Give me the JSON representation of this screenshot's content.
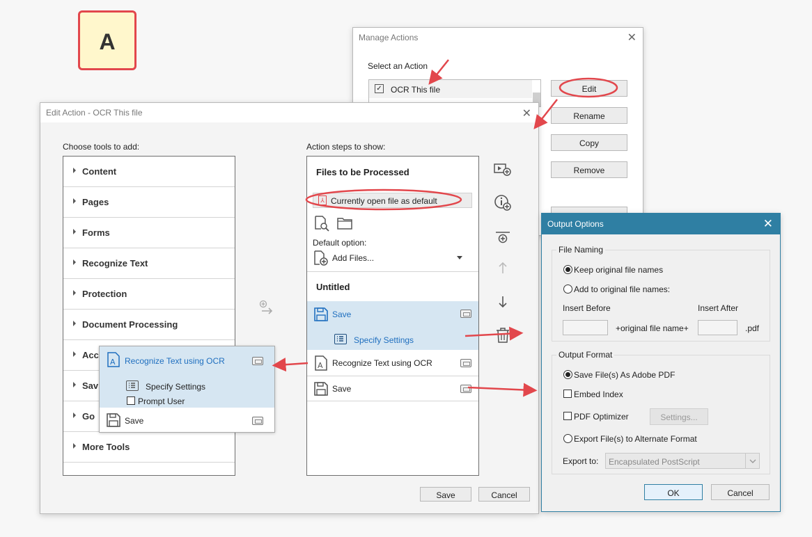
{
  "badge": {
    "letter": "A"
  },
  "manage_actions": {
    "title": "Manage Actions",
    "select_label": "Select an Action",
    "selected_action": "OCR This file",
    "buttons": {
      "edit": "Edit",
      "rename": "Rename",
      "copy": "Copy",
      "remove": "Remove"
    }
  },
  "edit_action": {
    "title": "Edit Action - OCR This file",
    "tools_heading": "Choose tools to add:",
    "steps_heading": "Action steps to show:",
    "tools": [
      "Content",
      "Pages",
      "Forms",
      "Recognize Text",
      "Protection",
      "Document Processing",
      "Acc",
      "Sav",
      "Go",
      "More Tools"
    ],
    "files_section": "Files to be Processed",
    "current_file": "Currently open file as default",
    "default_option_label": "Default option:",
    "add_files": "Add Files...",
    "untitled_section": "Untitled",
    "steps": {
      "save_1": "Save",
      "specify_settings": "Specify Settings",
      "recognize": "Recognize Text using OCR",
      "save_2": "Save"
    },
    "buttons": {
      "save": "Save",
      "cancel": "Cancel"
    }
  },
  "popup": {
    "recognize": "Recognize Text using OCR",
    "specify_settings": "Specify Settings",
    "prompt_user": "Prompt User",
    "save": "Save"
  },
  "output_options": {
    "title": "Output Options",
    "file_naming": {
      "title": "File Naming",
      "keep": "Keep original file names",
      "add": "Add to original file names:",
      "insert_before": "Insert Before",
      "insert_after": "Insert After",
      "middle": "+original file name+",
      "ext": ".pdf"
    },
    "output_format": {
      "title": "Output Format",
      "save_pdf": "Save File(s) As Adobe PDF",
      "embed_index": "Embed Index",
      "pdf_optimizer": "PDF Optimizer",
      "settings_button": "Settings...",
      "export_alt": "Export File(s) to Alternate Format",
      "export_to_label": "Export to:",
      "export_to_value": "Encapsulated PostScript"
    },
    "buttons": {
      "ok": "OK",
      "cancel": "Cancel"
    }
  },
  "colors": {
    "accent_blue": "#1f6fbf",
    "selection_bg": "#d6e6f2",
    "annotation_red": "#e2474c",
    "output_title_bg": "#2f7fa3"
  }
}
